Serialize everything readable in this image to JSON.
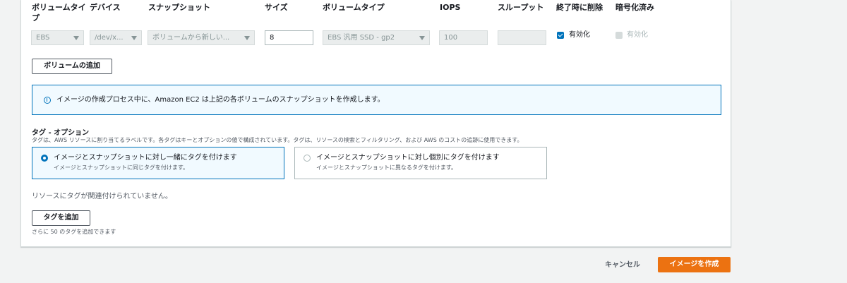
{
  "volumes": {
    "headers": {
      "volume_type": "ボリュームタイプ",
      "device": "デバイス",
      "snapshot": "スナップショット",
      "size": "サイズ",
      "ebs_volume_type": "ボリュームタイプ",
      "iops": "IOPS",
      "throughput": "スループット",
      "delete_on_termination": "終了時に削除",
      "encrypted": "暗号化済み"
    },
    "row": {
      "volume_type": "EBS",
      "device": "/dev/x...",
      "snapshot": "ボリュームから新しい...",
      "size": "8",
      "ebs_volume_type": "EBS 汎用 SSD - gp2",
      "iops": "100",
      "throughput": "",
      "delete_on_termination": {
        "checked": true,
        "label": "有効化"
      },
      "encrypted": {
        "checked": false,
        "label": "有効化"
      }
    },
    "add_volume_label": "ボリュームの追加"
  },
  "info": {
    "icon": "info-icon",
    "text": "イメージの作成プロセス中に、Amazon EC2 は上記の各ボリュームのスナップショットを作成します。"
  },
  "tags": {
    "title": "タグ - オプション",
    "description": "タグは、AWS リソースに割り当てるラベルです。各タグはキーとオプションの値で構成されています。タグは、リソースの検索とフィルタリング、および AWS のコストの追跡に使用できます。",
    "options": [
      {
        "title": "イメージとスナップショットに対し一緒にタグを付けます",
        "sub": "イメージとスナップショットに同じタグを付けます。",
        "selected": true
      },
      {
        "title": "イメージとスナップショットに対し個別にタグを付けます",
        "sub": "イメージとスナップショットに異なるタグを付けます。",
        "selected": false
      }
    ],
    "no_tags": "リソースにタグが関連付けられていません。",
    "add_tag_label": "タグを追加",
    "remaining": "さらに 50 のタグを追加できます"
  },
  "footer": {
    "cancel_label": "キャンセル",
    "create_label": "イメージを作成"
  },
  "colors": {
    "primary": "#ec7211",
    "link_blue": "#0073bb"
  }
}
